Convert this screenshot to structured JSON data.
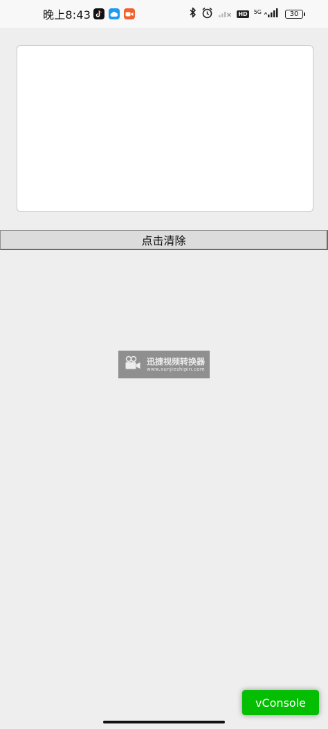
{
  "status_bar": {
    "time": "晚上8:43",
    "battery": "30",
    "network": "5G",
    "hd_label": "HD",
    "app_icons": [
      "tiktok-icon",
      "cloud-icon",
      "video-call-icon"
    ],
    "system_icons": [
      "bluetooth-icon",
      "alarm-icon",
      "wifi-off-icon",
      "signal-icon"
    ]
  },
  "editor": {
    "text": "",
    "placeholder": ""
  },
  "clear_button": {
    "label": "点击清除"
  },
  "watermark": {
    "title": "迅捷视频转换器",
    "url": "www.xunjieshipin.com"
  },
  "vconsole": {
    "label": "vConsole",
    "color": "#04be02"
  }
}
